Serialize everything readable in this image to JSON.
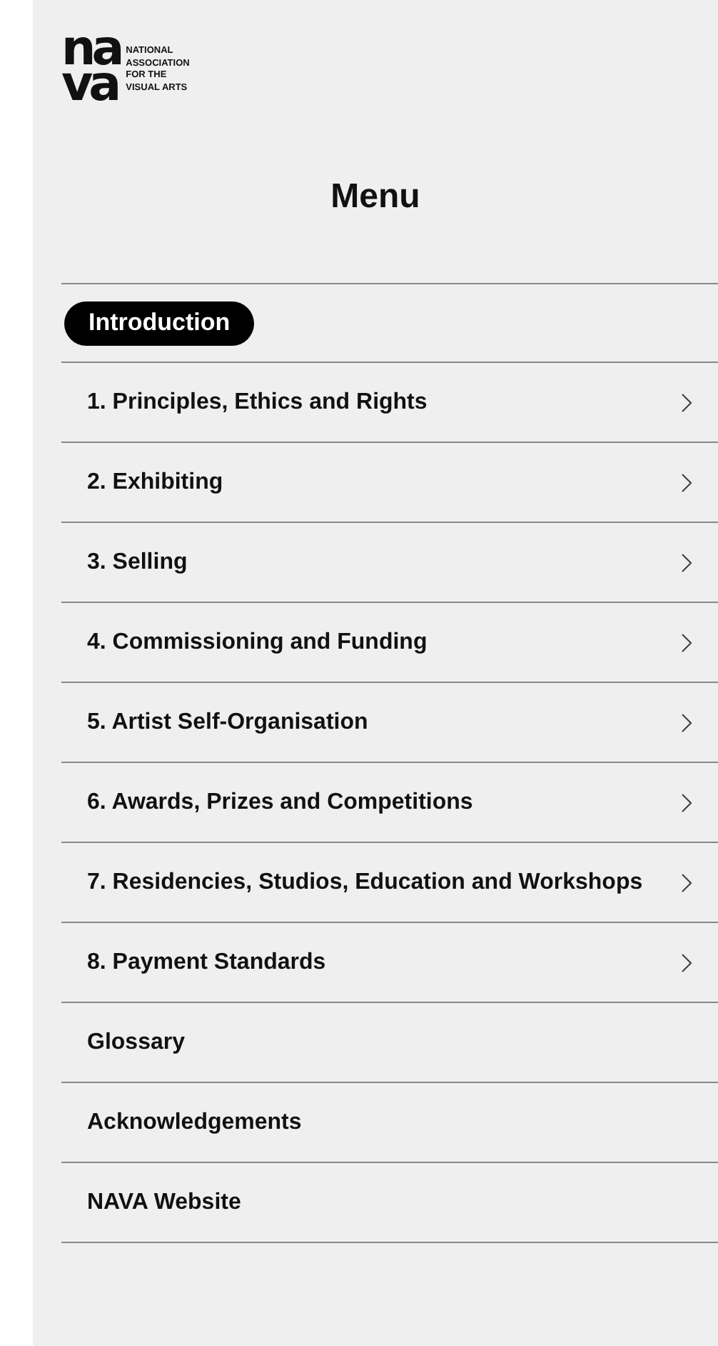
{
  "logo": {
    "mark_top": "na",
    "mark_bottom": "va",
    "wordmark": [
      "NATIONAL",
      "ASSOCIATION",
      "FOR THE",
      "VISUAL ARTS"
    ]
  },
  "title": "Menu",
  "items": [
    {
      "label": "Introduction",
      "selected": true,
      "has_submenu": false
    },
    {
      "label": "1. Principles, Ethics and Rights",
      "selected": false,
      "has_submenu": true
    },
    {
      "label": "2. Exhibiting",
      "selected": false,
      "has_submenu": true
    },
    {
      "label": "3. Selling",
      "selected": false,
      "has_submenu": true
    },
    {
      "label": "4. Commissioning and Funding",
      "selected": false,
      "has_submenu": true
    },
    {
      "label": "5. Artist Self-Organisation",
      "selected": false,
      "has_submenu": true
    },
    {
      "label": "6. Awards, Prizes and Competitions",
      "selected": false,
      "has_submenu": true
    },
    {
      "label": "7. Residencies, Studios, Education and Workshops",
      "selected": false,
      "has_submenu": true
    },
    {
      "label": "8. Payment Standards",
      "selected": false,
      "has_submenu": true
    },
    {
      "label": "Glossary",
      "selected": false,
      "has_submenu": false
    },
    {
      "label": "Acknowledgements",
      "selected": false,
      "has_submenu": false
    },
    {
      "label": "NAVA Website",
      "selected": false,
      "has_submenu": false
    }
  ]
}
